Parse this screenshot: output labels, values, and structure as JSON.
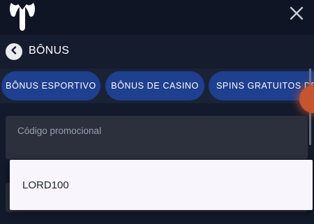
{
  "header": {
    "logo_icon": "elephant-logo-icon",
    "close_icon": "close-icon"
  },
  "page": {
    "back_icon": "chevron-left-icon",
    "title": "BÔNUS"
  },
  "tabs": [
    {
      "label": "BÔNUS ESPORTIVO"
    },
    {
      "label": "BÔNUS DE CASINO"
    },
    {
      "label": "SPINS GRATUITOS DE"
    }
  ],
  "promo": {
    "label": "Código promocional",
    "suggestions": [
      {
        "value": "LORD100"
      }
    ]
  },
  "colors": {
    "background": "#131a2b",
    "tab_bg": "#1f3f8f",
    "input_bg": "#2c303d",
    "dropdown_bg": "#f8f6fc"
  }
}
